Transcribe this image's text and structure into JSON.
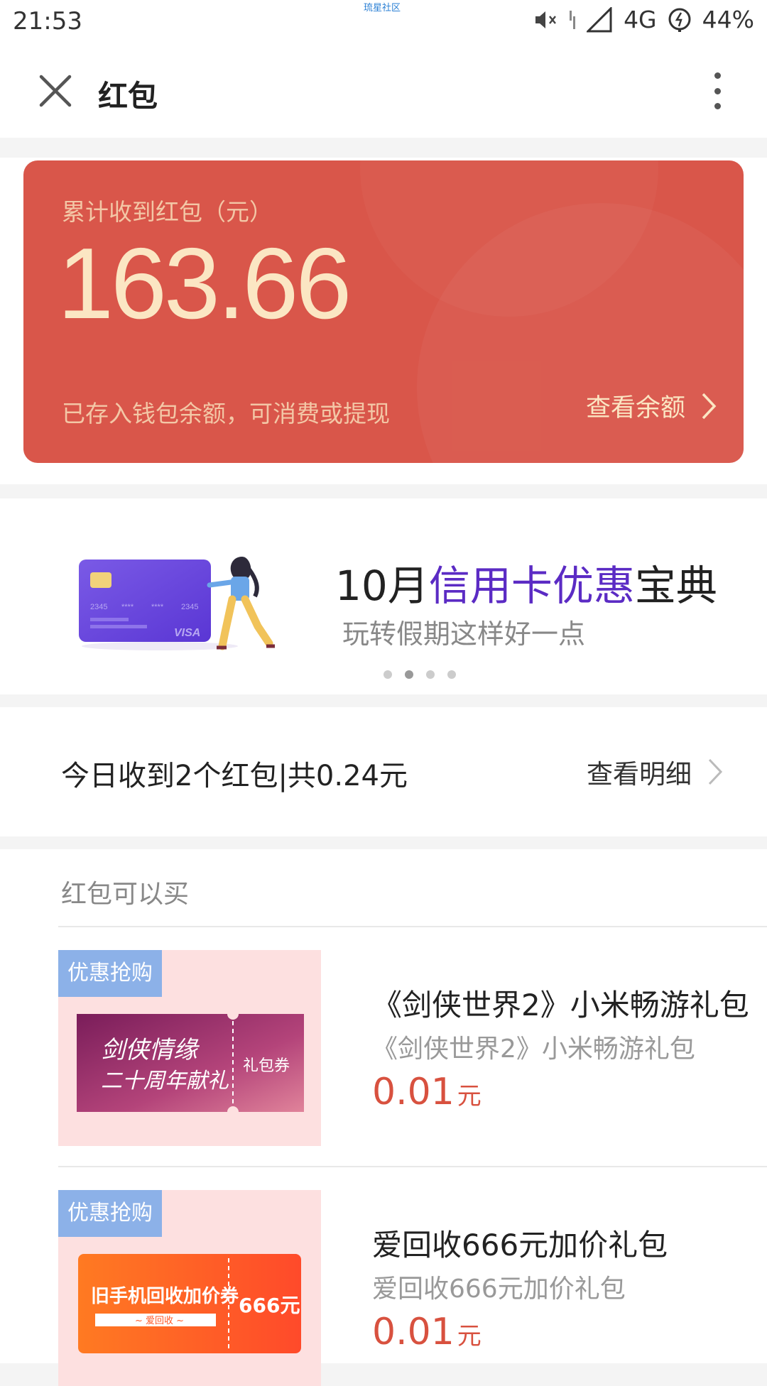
{
  "status_bar": {
    "time": "21:53",
    "watermark": "琉星社区",
    "network": "4G",
    "battery": "44%",
    "icons": [
      "mute-icon",
      "vibrate-icon",
      "signal-icon",
      "battery-icon"
    ]
  },
  "header": {
    "title": "红包",
    "icons": [
      "close-icon",
      "more-vertical-icon"
    ]
  },
  "balance_card": {
    "label": "累计收到红包（元）",
    "amount": "163.66",
    "note": "已存入钱包余额，可消费或提现",
    "view_balance": "查看余额",
    "colors": {
      "card": "#d9564a",
      "amount": "#fbe6c3",
      "label": "#f3c7a6"
    }
  },
  "banner": {
    "title_prefix": "10月",
    "title_highlight": "信用卡优惠",
    "title_suffix": "宝典",
    "subtitle": "玩转假期这样好一点",
    "card_number_left": "2345",
    "card_number_mid1": "****",
    "card_number_mid2": "****",
    "card_number_right": "2345",
    "card_brand": "VISA",
    "dots": 4,
    "active_dot": 1,
    "highlight_color": "#5b2bc4"
  },
  "today": {
    "summary": "今日收到2个红包|共0.24元",
    "view_details": "查看明细"
  },
  "shop": {
    "heading": "红包可以买",
    "products": [
      {
        "tag": "优惠抢购",
        "name": "《剑侠世界2》小米畅游礼包",
        "subtitle": "《剑侠世界2》小米畅游礼包",
        "price": "0.01",
        "unit": "元",
        "ticket_main_line1": "剑侠情缘",
        "ticket_main_line2": "二十周年献礼",
        "ticket_stub": "礼包券"
      },
      {
        "tag": "优惠抢购",
        "name": "爱回收666元加价礼包",
        "subtitle": "爱回收666元加价礼包",
        "price": "0.01",
        "unit": "元",
        "ticket_main_line1": "旧手机回收加价券",
        "ticket_main_line2": "~ 爱回收 ~",
        "ticket_stub": "666元"
      }
    ],
    "price_color": "#d8513f",
    "tag_color": "#8cb1e8"
  }
}
